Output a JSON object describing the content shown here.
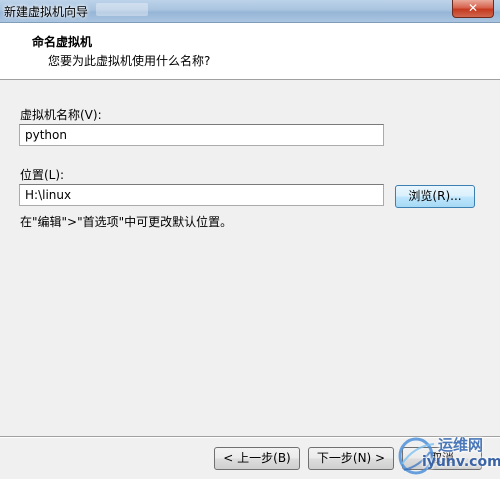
{
  "window": {
    "title": "新建虚拟机向导",
    "close_glyph": "✕"
  },
  "header": {
    "title": "命名虚拟机",
    "subtitle": "您要为此虚拟机使用什么名称?"
  },
  "form": {
    "name_label": "虚拟机名称(V):",
    "name_value": "python",
    "location_label": "位置(L):",
    "location_value": "H:\\linux",
    "browse_label": "浏览(R)...",
    "hint": "在\"编辑\">\"首选项\"中可更改默认位置。"
  },
  "footer": {
    "back_label": "< 上一步(B)",
    "next_label": "下一步(N) >",
    "cancel_label": "取消"
  },
  "watermark": {
    "line1": "运维网",
    "line2": "iyunv.com"
  },
  "colors": {
    "focus_border": "#3c7fb1",
    "watermark_blue": "#4a78b8"
  }
}
